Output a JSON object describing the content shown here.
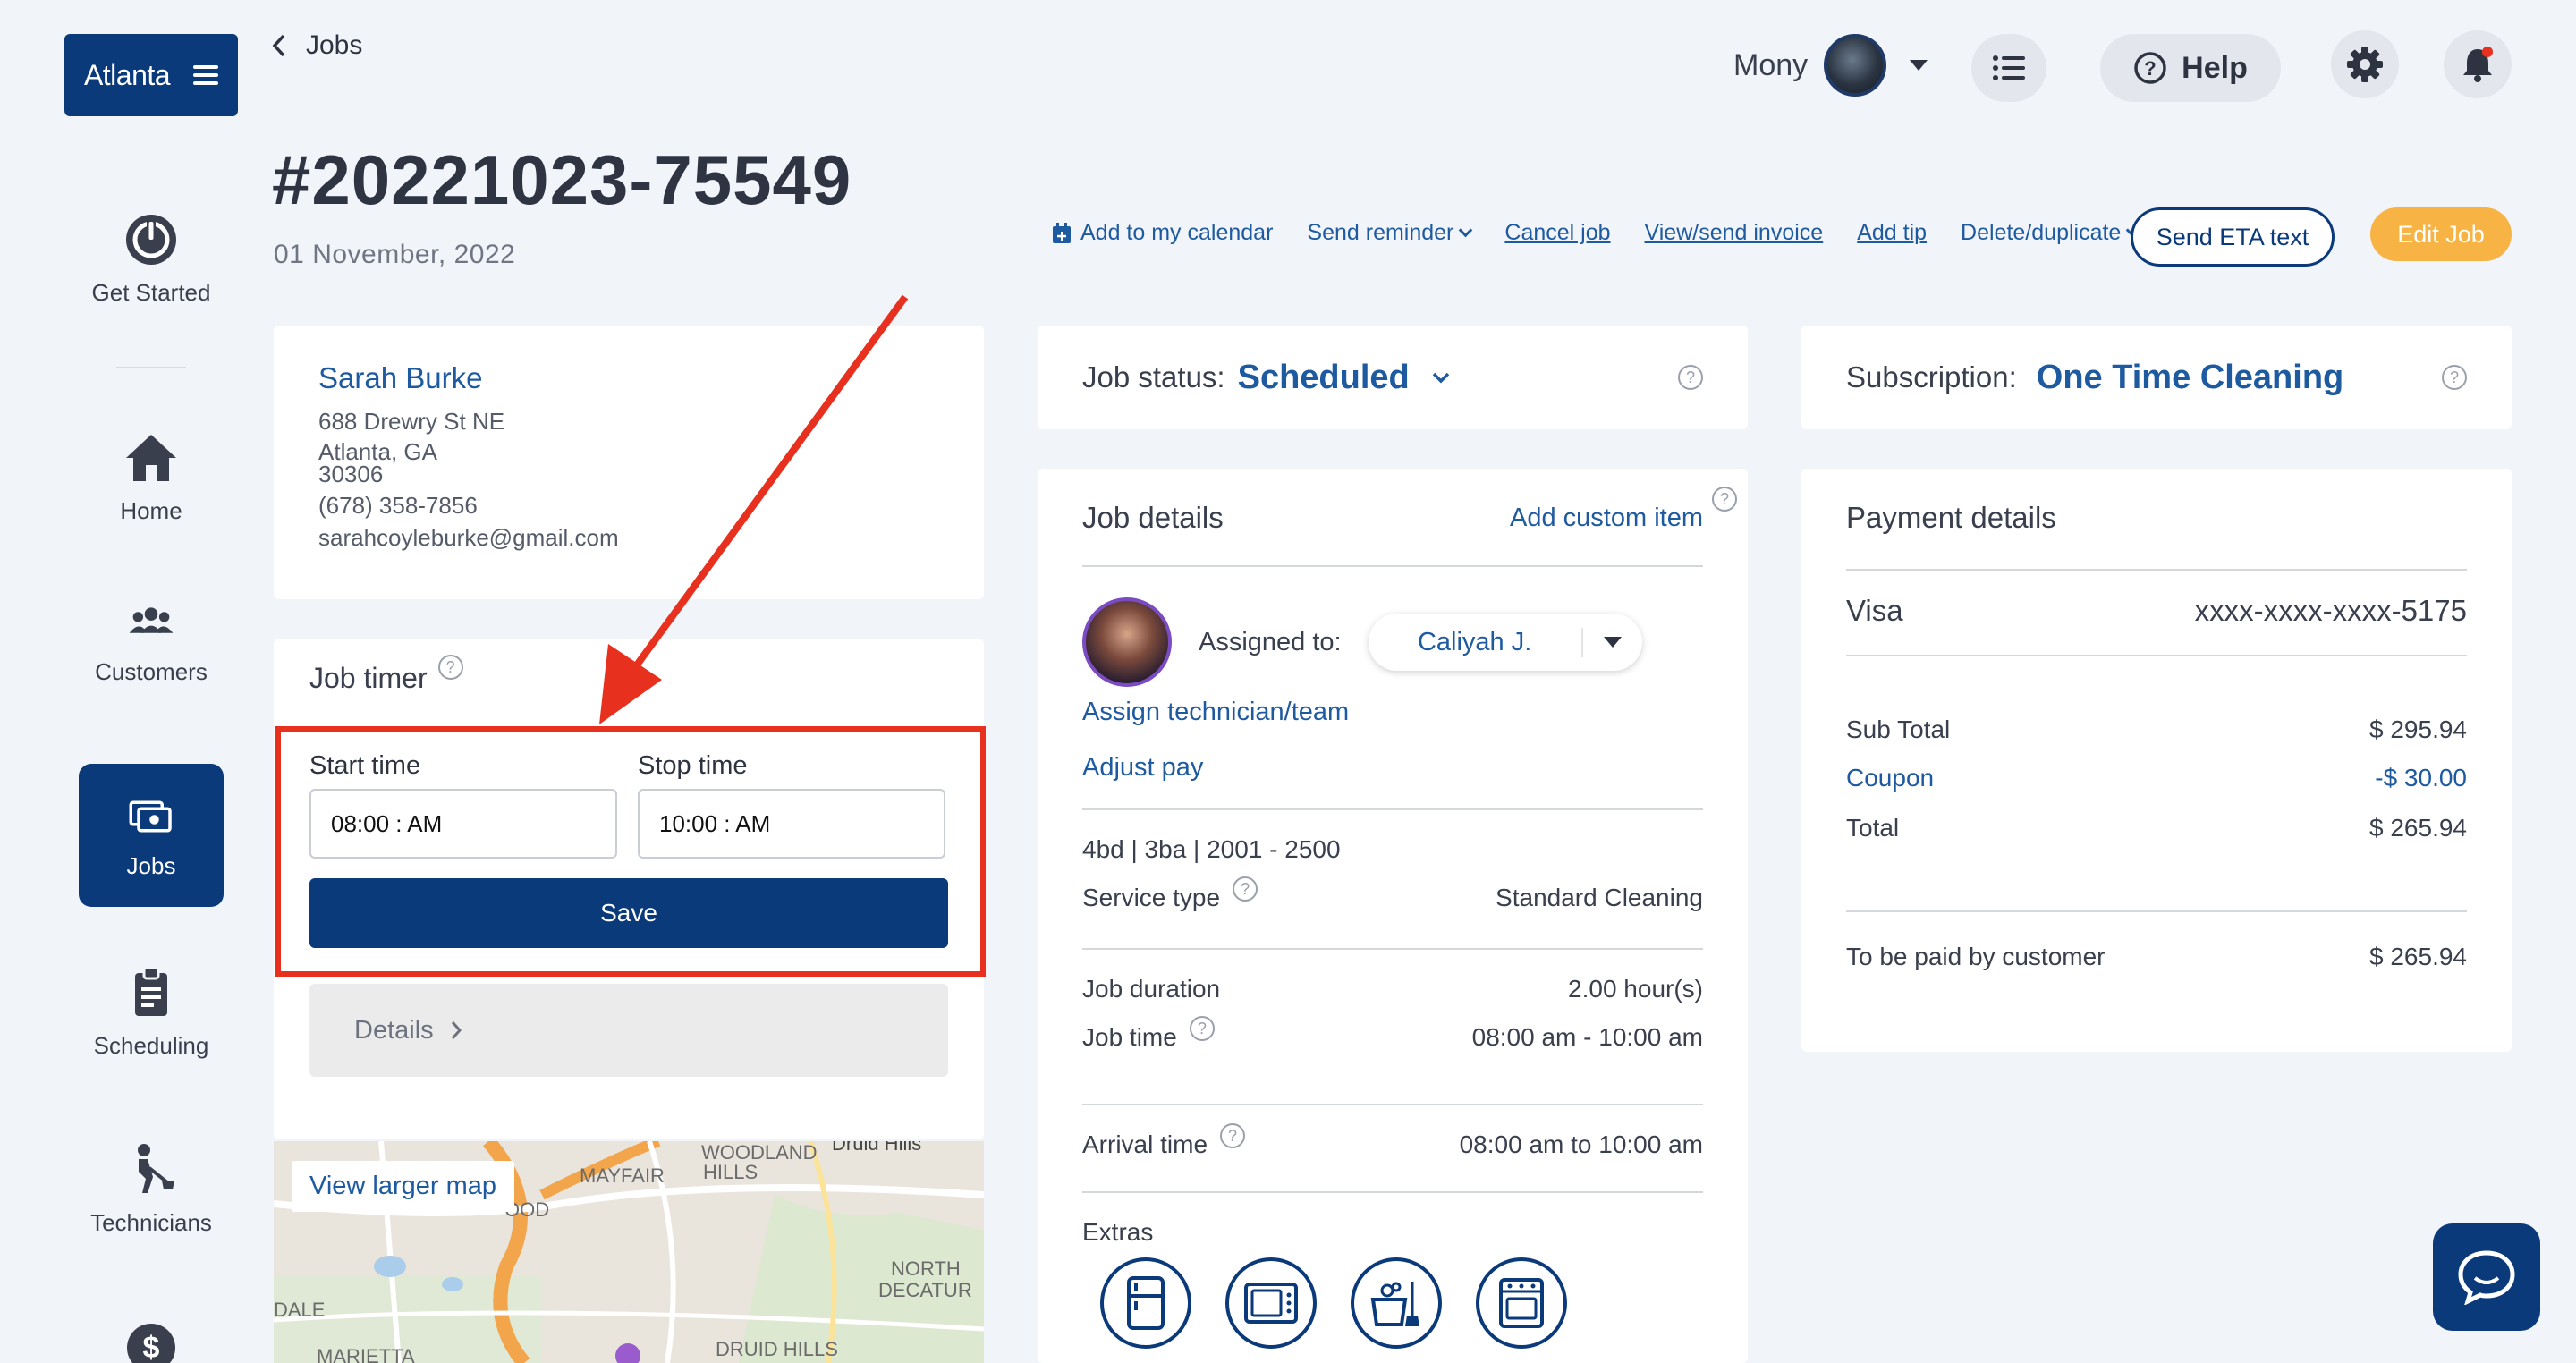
{
  "brand": {
    "label": "Atlanta"
  },
  "sidebar": {
    "items": [
      {
        "label": "Get Started"
      },
      {
        "label": "Home"
      },
      {
        "label": "Customers"
      },
      {
        "label": "Jobs"
      },
      {
        "label": "Scheduling"
      },
      {
        "label": "Technicians"
      }
    ]
  },
  "header": {
    "back_label": "Jobs",
    "user_name": "Mony",
    "help_label": "Help"
  },
  "job": {
    "id": "#20221023-75549",
    "date": "01 November, 2022"
  },
  "actions": {
    "add_calendar": "Add to my calendar",
    "send_reminder": "Send reminder",
    "cancel_job": "Cancel job",
    "view_invoice": "View/send invoice",
    "add_tip": "Add tip",
    "delete_duplicate": "Delete/duplicate",
    "send_eta": "Send ETA text",
    "edit_job": "Edit Job"
  },
  "customer": {
    "name": "Sarah Burke",
    "street": "688 Drewry St NE",
    "city": "Atlanta, GA",
    "zip": "30306",
    "phone": "(678) 358-7856",
    "email": "sarahcoyleburke@gmail.com"
  },
  "timer": {
    "title": "Job timer",
    "start_label": "Start time",
    "start_value": "08:00 : AM",
    "stop_label": "Stop time",
    "stop_value": "10:00 : AM",
    "save_label": "Save",
    "details_label": "Details"
  },
  "map": {
    "link": "View larger map",
    "labels": [
      "WOODLAND",
      "HILLS",
      "MAYFAIR",
      "OOD",
      "NORTH",
      "DECATUR",
      "DALE",
      "MARIETTA",
      "DRUID HILLS",
      "Druid Hills"
    ]
  },
  "status": {
    "label": "Job status:",
    "value": "Scheduled"
  },
  "subscription": {
    "label": "Subscription:",
    "value": "One Time Cleaning"
  },
  "job_details": {
    "title": "Job details",
    "add_custom": "Add custom item",
    "assigned_label": "Assigned to:",
    "assigned_value": "Caliyah J.",
    "assign_link": "Assign technician/team",
    "adjust_pay": "Adjust pay",
    "size": "4bd | 3ba | 2001 - 2500",
    "service_type_label": "Service type",
    "service_type_value": "Standard Cleaning",
    "duration_label": "Job duration",
    "duration_value": "2.00 hour(s)",
    "job_time_label": "Job time",
    "job_time_value": "08:00 am - 10:00 am",
    "arrival_label": "Arrival time",
    "arrival_value": "08:00 am to 10:00 am",
    "extras_label": "Extras",
    "extras": [
      "fridge-icon",
      "microwave-icon",
      "dishes-icon",
      "oven-icon"
    ]
  },
  "payment": {
    "title": "Payment details",
    "card_type": "Visa",
    "card_number": "xxxx-xxxx-xxxx-5175",
    "subtotal_label": "Sub Total",
    "subtotal_value": "$ 295.94",
    "coupon_label": "Coupon",
    "coupon_value": "-$ 30.00",
    "total_label": "Total",
    "total_value": "$ 265.94",
    "to_pay_label": "To be paid by customer",
    "to_pay_value": "$ 265.94"
  },
  "colors": {
    "primary": "#0b3a7a",
    "link": "#1e5aa0",
    "accent": "#f8b345",
    "annotation": "#e8301e"
  }
}
